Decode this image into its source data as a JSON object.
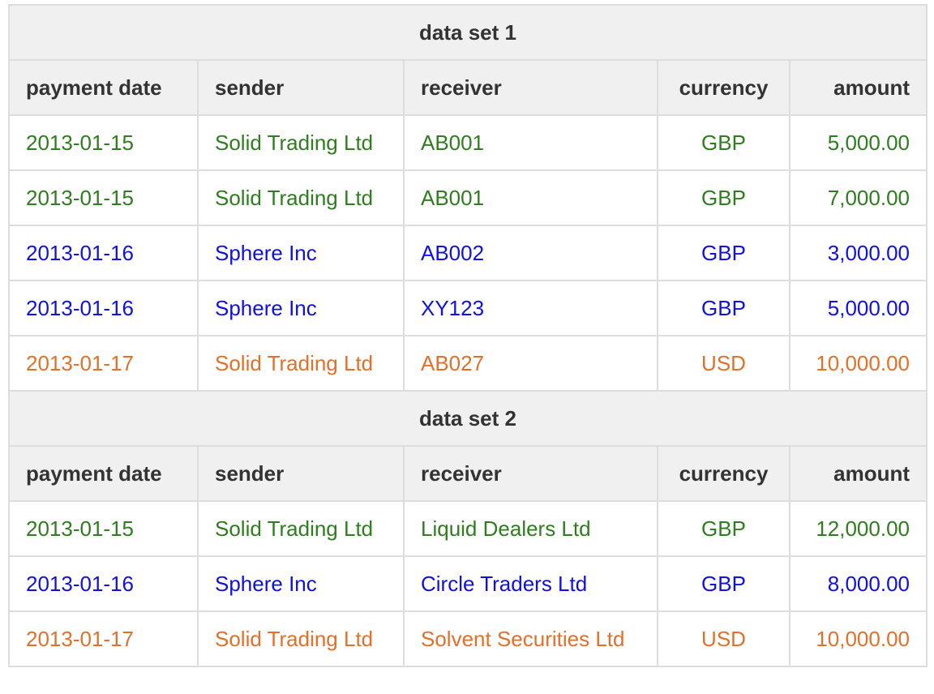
{
  "colors": {
    "green": "#2e7d1e",
    "blue": "#1010e0",
    "orange": "#e0702a",
    "header_bg": "#f0f0f0",
    "border": "#dddddd"
  },
  "headers": [
    "payment date",
    "sender",
    "receiver",
    "currency",
    "amount"
  ],
  "sets": [
    {
      "title": "data set 1",
      "rows": [
        {
          "color": "green",
          "cells": [
            "2013-01-15",
            "Solid Trading Ltd",
            "AB001",
            "GBP",
            "5,000.00"
          ]
        },
        {
          "color": "green",
          "cells": [
            "2013-01-15",
            "Solid Trading Ltd",
            "AB001",
            "GBP",
            "7,000.00"
          ]
        },
        {
          "color": "blue",
          "cells": [
            "2013-01-16",
            "Sphere Inc",
            "AB002",
            "GBP",
            "3,000.00"
          ]
        },
        {
          "color": "blue",
          "cells": [
            "2013-01-16",
            "Sphere Inc",
            "XY123",
            "GBP",
            "5,000.00"
          ]
        },
        {
          "color": "orange",
          "cells": [
            "2013-01-17",
            "Solid Trading Ltd",
            "AB027",
            "USD",
            "10,000.00"
          ]
        }
      ]
    },
    {
      "title": "data set 2",
      "rows": [
        {
          "color": "green",
          "cells": [
            "2013-01-15",
            "Solid Trading Ltd",
            "Liquid Dealers Ltd",
            "GBP",
            "12,000.00"
          ]
        },
        {
          "color": "blue",
          "cells": [
            "2013-01-16",
            "Sphere Inc",
            "Circle Traders Ltd",
            "GBP",
            "8,000.00"
          ]
        },
        {
          "color": "orange",
          "cells": [
            "2013-01-17",
            "Solid Trading Ltd",
            "Solvent Securities Ltd",
            "USD",
            "10,000.00"
          ]
        }
      ]
    }
  ]
}
